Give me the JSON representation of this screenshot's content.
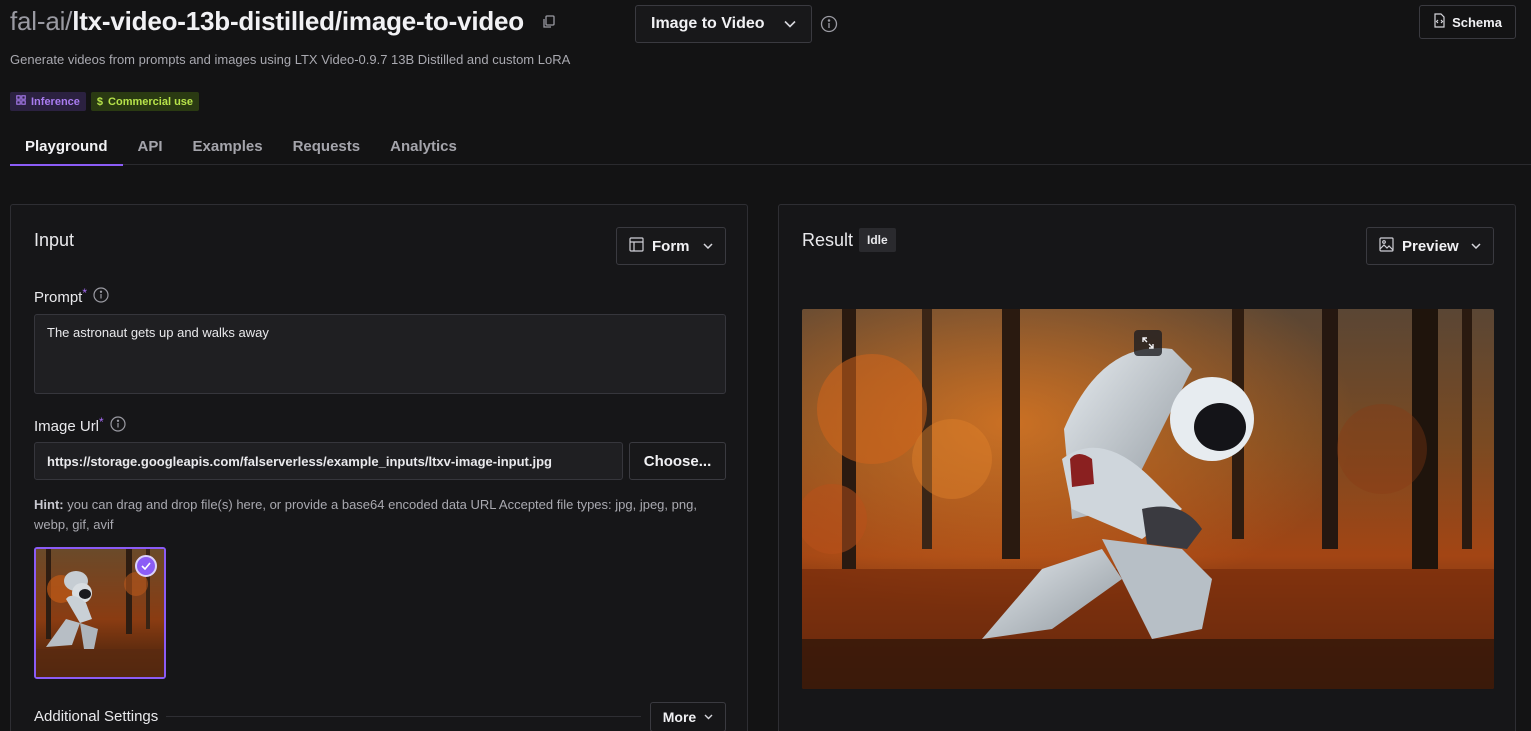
{
  "header": {
    "org": "fal-ai",
    "separator": "/",
    "model": "ltx-video-13b-distilled/image-to-video",
    "mode": "Image to Video",
    "schema_label": "Schema",
    "subtitle": "Generate videos from prompts and images using LTX Video-0.9.7 13B Distilled and custom LoRA"
  },
  "badges": {
    "inference": "Inference",
    "commercial": "Commercial use"
  },
  "tabs": [
    {
      "label": "Playground",
      "active": true
    },
    {
      "label": "API"
    },
    {
      "label": "Examples"
    },
    {
      "label": "Requests"
    },
    {
      "label": "Analytics"
    }
  ],
  "input": {
    "title": "Input",
    "view_mode": "Form",
    "prompt_label": "Prompt",
    "required_mark": "*",
    "prompt_value": "The astronaut gets up and walks away",
    "image_url_label": "Image Url",
    "image_url_value": "https://storage.googleapis.com/falserverless/example_inputs/ltxv-image-input.jpg",
    "choose_label": "Choose...",
    "hint_label": "Hint:",
    "hint_text": "you can drag and drop file(s) here, or provide a base64 encoded data URL Accepted file types: jpg, jpeg, png, webp, gif, avif",
    "additional_settings": "Additional Settings",
    "more_label": "More"
  },
  "result": {
    "title": "Result",
    "status": "Idle",
    "view_mode": "Preview"
  },
  "colors": {
    "accent": "#8b5cf6",
    "background": "#131314",
    "inference_badge": "#a97cf0",
    "commercial_badge": "#b6e24a"
  }
}
